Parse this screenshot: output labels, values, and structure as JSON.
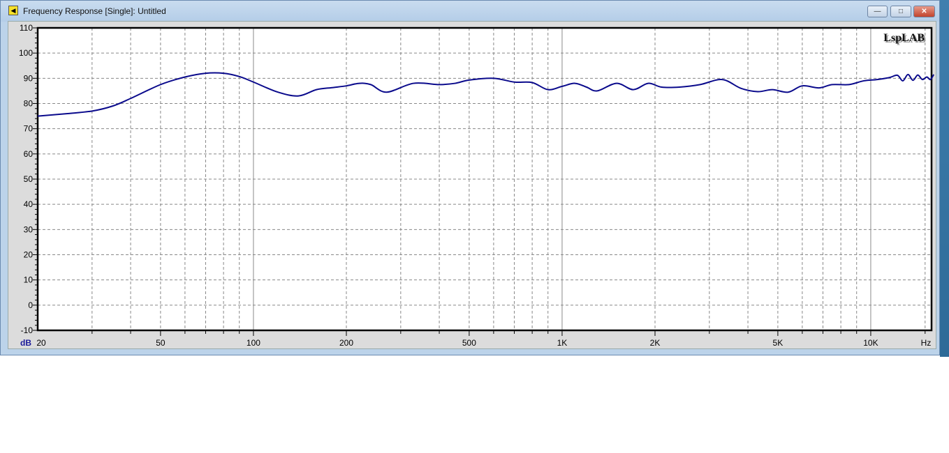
{
  "window": {
    "title": "Frequency Response [Single]: Untitled",
    "minimize": "—",
    "maximize": "□",
    "close": "✕",
    "app_icon": "speaker-icon"
  },
  "chart_data": {
    "type": "line",
    "title": "",
    "watermark": "LspLAB",
    "xlabel": "Hz",
    "ylabel": "dB",
    "xscale": "log",
    "xlim": [
      20,
      16000
    ],
    "ylim": [
      -10,
      110
    ],
    "grid": true,
    "yticks": [
      "110",
      "100",
      "90",
      "80",
      "70",
      "60",
      "50",
      "40",
      "30",
      "20",
      "10",
      "0",
      "-10"
    ],
    "xticks": [
      {
        "v": 20,
        "label": "20"
      },
      {
        "v": 50,
        "label": "50"
      },
      {
        "v": 100,
        "label": "100"
      },
      {
        "v": 200,
        "label": "200"
      },
      {
        "v": 500,
        "label": "500"
      },
      {
        "v": 1000,
        "label": "1K"
      },
      {
        "v": 2000,
        "label": "2K"
      },
      {
        "v": 5000,
        "label": "5K"
      },
      {
        "v": 10000,
        "label": "10K"
      }
    ],
    "series": [
      {
        "name": "Frequency Response",
        "color": "#0a0a8c",
        "x": [
          20,
          25,
          30,
          35,
          40,
          50,
          60,
          70,
          80,
          90,
          100,
          120,
          140,
          160,
          180,
          200,
          220,
          240,
          270,
          330,
          400,
          450,
          500,
          600,
          700,
          800,
          900,
          1000,
          1100,
          1200,
          1300,
          1500,
          1700,
          1900,
          2100,
          2400,
          2800,
          3300,
          3800,
          4300,
          4800,
          5400,
          6000,
          6800,
          7500,
          8500,
          9500,
          10500,
          11500,
          12200,
          12700,
          13200,
          13700,
          14200,
          14700,
          15200,
          15600,
          16000
        ],
        "y": [
          75,
          76,
          77,
          79,
          82,
          87.5,
          90.5,
          92,
          92,
          90.7,
          88.5,
          84.5,
          83,
          85.5,
          86.3,
          87,
          88,
          87.5,
          84.5,
          88,
          87.5,
          88,
          89.3,
          90,
          88.5,
          88.3,
          85.5,
          86.8,
          88,
          86.5,
          85,
          88,
          85.5,
          88,
          86.5,
          86.5,
          87.5,
          89.5,
          86,
          84.7,
          85.5,
          84.5,
          87,
          86.2,
          87.5,
          87.5,
          89,
          89.5,
          90.3,
          91.2,
          89,
          91.5,
          89.2,
          91.3,
          89.5,
          90.5,
          89.5,
          91.5
        ]
      }
    ]
  }
}
